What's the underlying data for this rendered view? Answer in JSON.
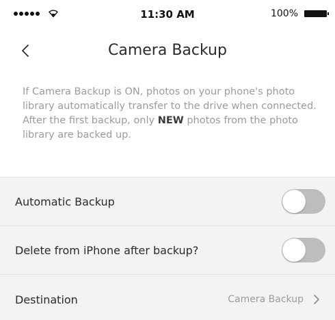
{
  "status_bar": {
    "signal_dots": 5,
    "wifi_icon": "wifi-icon",
    "time": "11:30 AM",
    "battery_percent": "100%",
    "battery_icon": "battery-icon"
  },
  "nav": {
    "back_icon": "chevron-left-icon",
    "title": "Camera Backup"
  },
  "description": {
    "text_before": "If Camera Backup is ON, photos on your phone's photo library automatically transfer to the drive when connected. After the first backup, only ",
    "emphasis": "NEW",
    "text_after": " photos from the photo library are backed up."
  },
  "settings": {
    "automatic_backup": {
      "label": "Automatic Backup",
      "enabled": false
    },
    "delete_after_backup": {
      "label": "Delete from iPhone after backup?",
      "enabled": false
    },
    "destination": {
      "label": "Destination",
      "value": "Camera Backup",
      "icon": "chevron-right-icon"
    }
  },
  "colors": {
    "toggle_off": "#bdbdbd",
    "list_background": "#f3f3f3",
    "secondary_text": "#9b9b9b"
  }
}
